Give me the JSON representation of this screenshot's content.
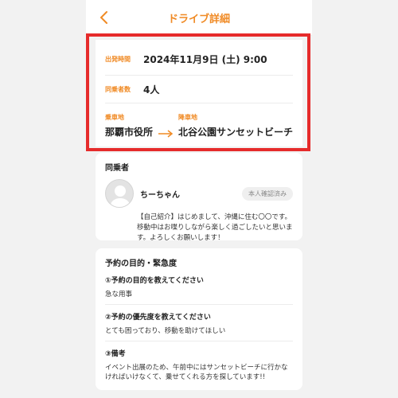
{
  "header": {
    "title": "ドライブ詳細"
  },
  "ride": {
    "departure_label": "出発時間",
    "departure_value": "2024年11月9日 (土)   9:00",
    "passengers_label": "同乗者数",
    "passengers_value": "4人",
    "pickup_label": "乗車地",
    "pickup_value": "那覇市役所",
    "dropoff_label": "降車地",
    "dropoff_value": "北谷公園サンセットビーチ"
  },
  "companion": {
    "section_title": "同乗者",
    "name": "ちーちゃん",
    "badge": "本人確認済み",
    "intro": "【自己紹介】はじめまして、沖縄に住む〇〇です。移動中はお喋りしながら楽しく過ごしたいと思います。よろしくお願いします！"
  },
  "purpose": {
    "section_title": "予約の目的・緊急度",
    "questions": [
      {
        "title": "①予約の目的を教えてください",
        "answer": "急な用事"
      },
      {
        "title": "②予約の優先度を教えてください",
        "answer": "とても困っており、移動を助けてほしい"
      },
      {
        "title": "③備考",
        "answer": "イベント出展のため、午前中にはサンセットビーチに行かなければいけなくて、乗せてくれる方を探しています!!"
      }
    ]
  },
  "colors": {
    "accent": "#f08a24",
    "highlight": "#e62b2b"
  },
  "icons": {
    "back": "chevron-left-icon",
    "arrow": "arrow-right-icon",
    "avatar": "user-avatar-icon"
  }
}
